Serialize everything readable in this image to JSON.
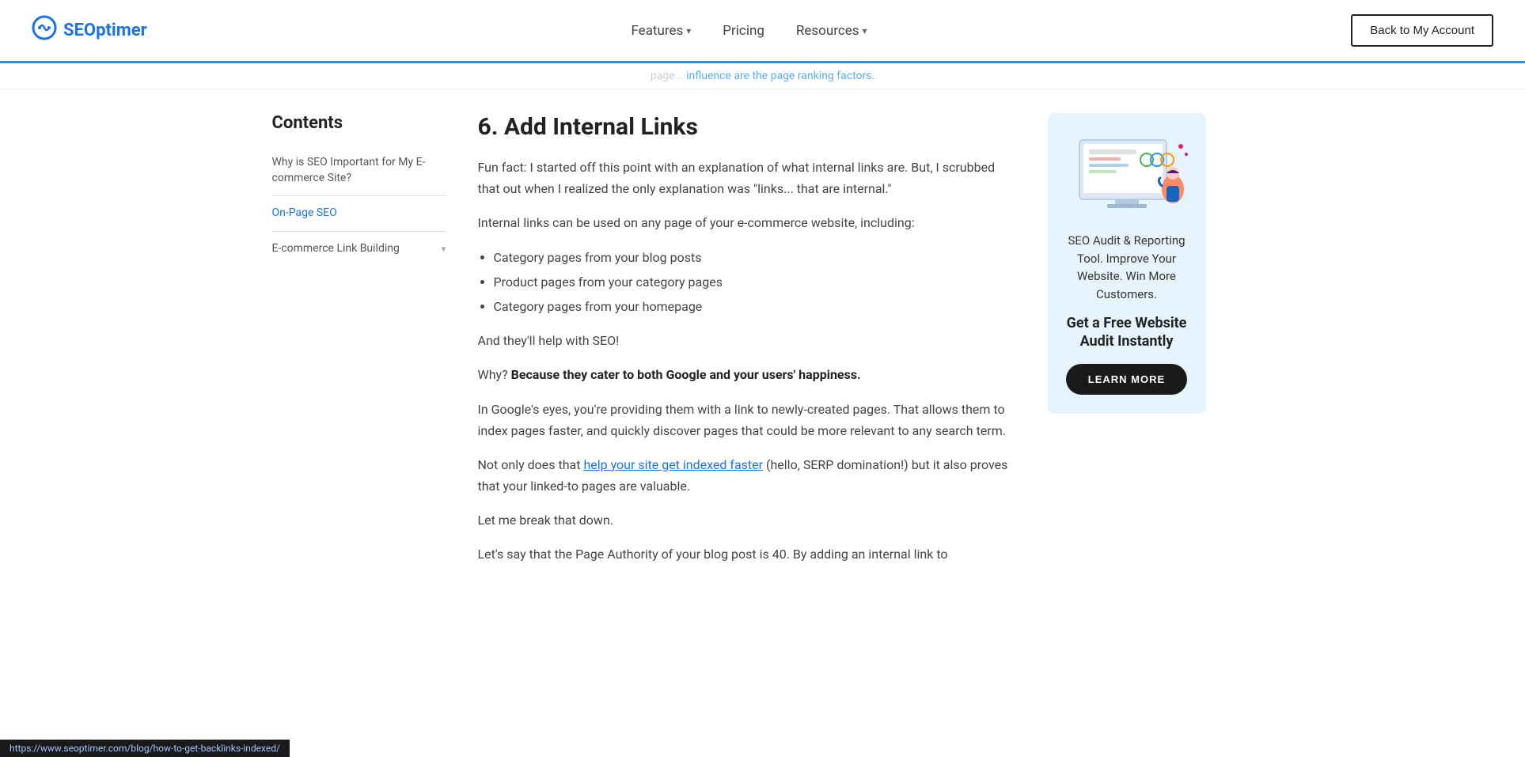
{
  "header": {
    "logo_text": "SEOptimer",
    "logo_prefix": "SEO",
    "logo_suffix": "ptimer",
    "nav_items": [
      {
        "label": "Features",
        "has_arrow": true
      },
      {
        "label": "Pricing",
        "has_arrow": false
      },
      {
        "label": "Resources",
        "has_arrow": true
      }
    ],
    "back_button": "Back to My Account"
  },
  "faded_bar": {
    "text": "page... influence are the page ranking factors."
  },
  "sidebar": {
    "title": "Contents",
    "items": [
      {
        "label": "Why is SEO Important for My E-commerce Site?",
        "active": false,
        "has_arrow": false
      },
      {
        "label": "On-Page SEO",
        "active": true,
        "has_arrow": false
      },
      {
        "label": "E-commerce Link Building",
        "active": false,
        "has_arrow": true
      }
    ]
  },
  "article": {
    "section_number": "6.",
    "heading": "Add Internal Links",
    "paragraphs": [
      "Fun fact: I started off this point with an explanation of what internal links are. But, I scrubbed that out when I realized the only explanation was \"links... that are internal.\"",
      "Internal links can be used on any page of your e-commerce website, including:",
      null,
      "And they'll help with SEO!",
      "Why? Because they cater to both Google and your users' happiness.",
      "In Google's eyes, you're providing them with a link to newly-created pages. That allows them to index pages faster, and quickly discover pages that could be more relevant to any search term.",
      "Not only does that help your site get indexed faster (hello, SERP domination!) but it also proves that your linked-to pages are valuable.",
      "Let me break that down.",
      "Let's say that the Page Authority of your blog post is 40. By adding an internal link to"
    ],
    "list_items": [
      "Category pages from your blog posts",
      "Product pages from your category pages",
      "Category pages from your homepage"
    ],
    "bold_sentence": "Because they cater to both Google and your users' happiness.",
    "link_text": "help your site get indexed faster",
    "link_href": "https://www.seoptimer.com/blog/how-to-get-backlinks-indexed/"
  },
  "widget": {
    "desc": "SEO Audit & Reporting Tool. Improve Your Website. Win More Customers.",
    "cta_title": "Get a Free Website Audit Instantly",
    "button_label": "LEARN MORE"
  },
  "status_bar": {
    "url": "https://www.seoptimer.com/blog/how-to-get-backlinks-indexed/"
  }
}
